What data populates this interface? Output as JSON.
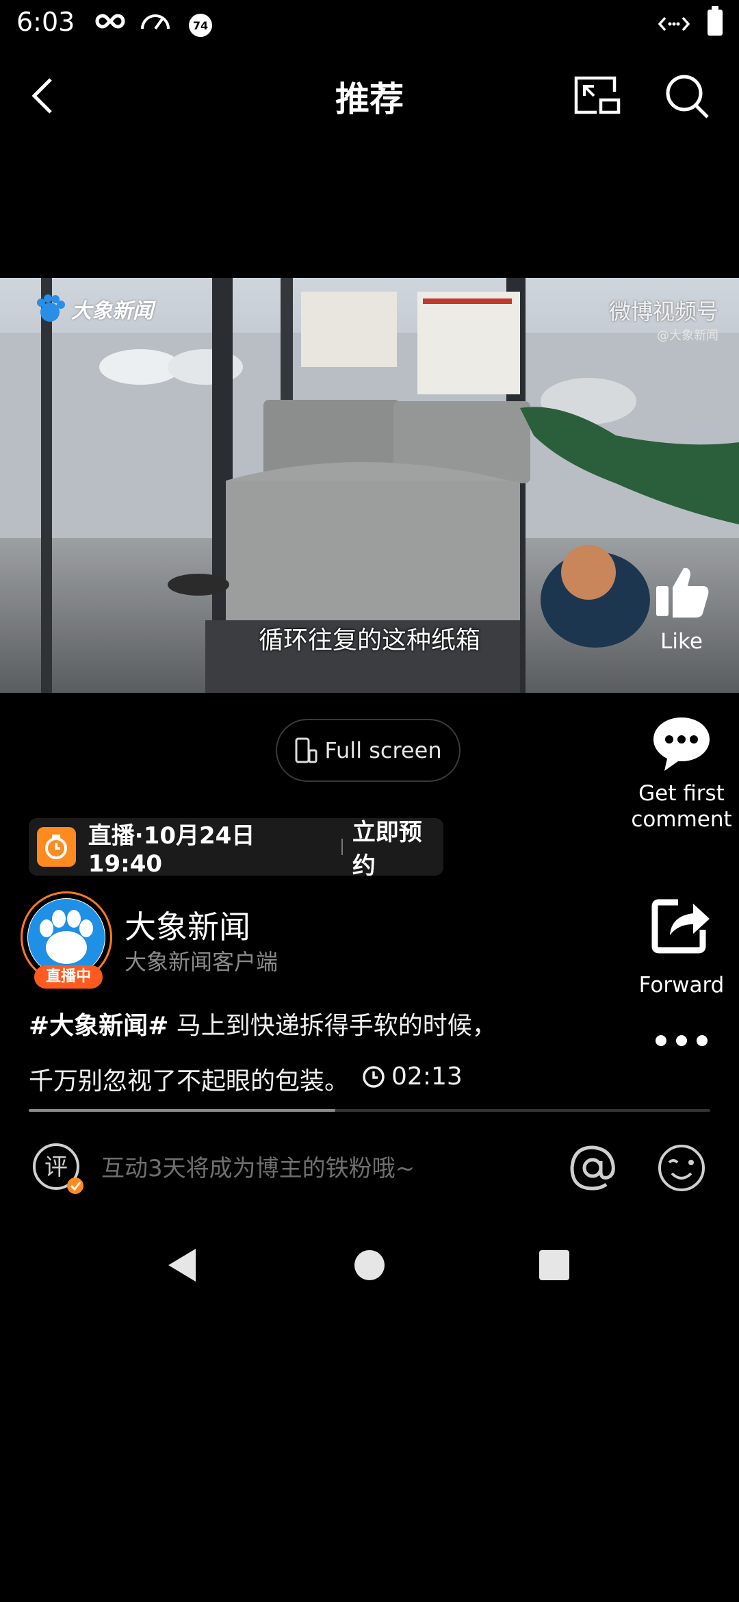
{
  "status_bar": {
    "time": "6:03",
    "badge_number": "74",
    "icons": [
      "infinity-icon",
      "speedometer-icon",
      "notification-badge-icon",
      "code-arrows-icon",
      "battery-icon"
    ]
  },
  "header": {
    "title": "推荐",
    "icons": [
      "back-arrow-icon",
      "picture-in-picture-icon",
      "search-icon"
    ]
  },
  "video": {
    "subtitle": "循环往复的这种纸箱",
    "watermark_left": "大象新闻",
    "watermark_right": "微博视频号",
    "watermark_right_sub": "@大象新闻",
    "progress": 0.45
  },
  "actions": {
    "like_label": "Like",
    "comment_label": "Get first comment",
    "forward_label": "Forward",
    "icons": [
      "thumbs-up-icon",
      "comment-bubble-icon",
      "share-icon",
      "more-icon"
    ]
  },
  "fullscreen": {
    "label": "Full screen"
  },
  "live_banner": {
    "text": "直播·10月24日 19:40",
    "reserve": "立即预约",
    "icon": "clock-icon",
    "accent": "#ff8a1f"
  },
  "author": {
    "name": "大象新闻",
    "subtitle": "大象新闻客户端",
    "live_badge": "直播中",
    "ring_color": "#ff7a1a"
  },
  "caption": {
    "hashtag": "#大象新闻#",
    "line1": " 马上到快递拆得手软的时候，",
    "line2": "千万别忽视了不起眼的包装。",
    "duration": "02:13"
  },
  "comment_bar": {
    "icon_text": "评",
    "placeholder": "互动3天将成为博主的铁粉哦~",
    "icons": [
      "at-icon",
      "emoji-icon"
    ]
  },
  "nav_bar": {
    "icons": [
      "nav-back-icon",
      "nav-home-icon",
      "nav-recent-icon"
    ]
  }
}
